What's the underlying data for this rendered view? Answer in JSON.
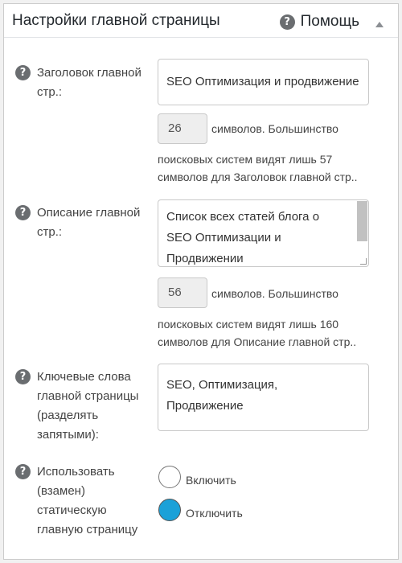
{
  "header": {
    "title": "Настройки главной страницы",
    "help_label": "Помощь"
  },
  "fields": {
    "home_title": {
      "label_lines": [
        "Заголовок главной",
        "стр.:"
      ],
      "value": "SEO Оптимизация  и продвижение",
      "char_count": "26",
      "count_note": "символов. Большинство",
      "count_desc": [
        "поисковых систем видят лишь 57",
        "символов для Заголовок главной стр.."
      ]
    },
    "home_description": {
      "label_lines": [
        "Описание главной",
        "стр.:"
      ],
      "value_lines": [
        "Список всех статей блога о",
        "SEO Оптимизации и",
        "Продвижении"
      ],
      "char_count": "56",
      "count_note": "символов. Большинство",
      "count_desc": [
        "поисковых систем видят лишь 160",
        "символов для Описание главной стр.."
      ]
    },
    "home_keywords": {
      "label_lines": [
        "Ключевые слова",
        "главной страницы",
        "(разделять",
        "запятыми):"
      ],
      "value_lines": [
        "SEO, Оптимизация,",
        "Продвижение"
      ]
    },
    "static_front": {
      "label_lines": [
        "Использовать",
        "(взамен)",
        "статическую",
        "главную страницу"
      ],
      "options": [
        {
          "label": "Включить",
          "checked": false
        },
        {
          "label": "Отключить",
          "checked": true
        }
      ]
    }
  },
  "colors": {
    "accent": "#1ba1d8",
    "help_icon": "#6a6d70"
  },
  "icons": {
    "help": "question-circle-icon",
    "collapse": "triangle-up-icon"
  }
}
